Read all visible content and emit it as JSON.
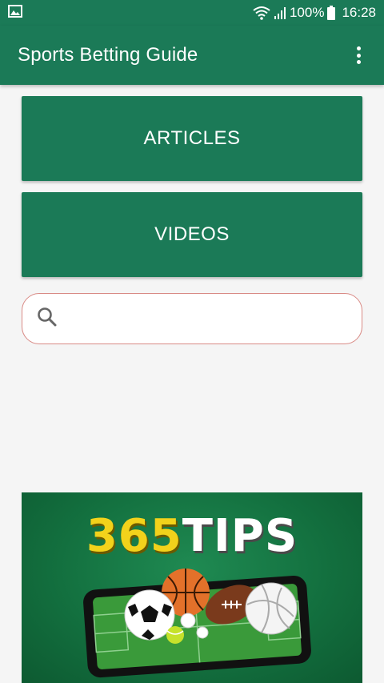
{
  "status_bar": {
    "battery_percent": "100%",
    "time": "16:28",
    "icons": [
      "image-icon",
      "wifi-icon",
      "signal-icon",
      "battery-icon"
    ]
  },
  "app_bar": {
    "title": "Sports Betting Guide",
    "menu_icon": "overflow-menu-icon"
  },
  "main": {
    "articles_label": "ARTICLES",
    "videos_label": "VIDEOS",
    "search": {
      "value": "",
      "placeholder": "",
      "icon": "search-icon"
    }
  },
  "banner": {
    "logo_number": "365",
    "logo_word": "TIPS"
  },
  "colors": {
    "primary": "#1b7a57",
    "background": "#f5f5f5",
    "search_border": "#d98a85",
    "logo_yellow": "#f2d21b"
  }
}
